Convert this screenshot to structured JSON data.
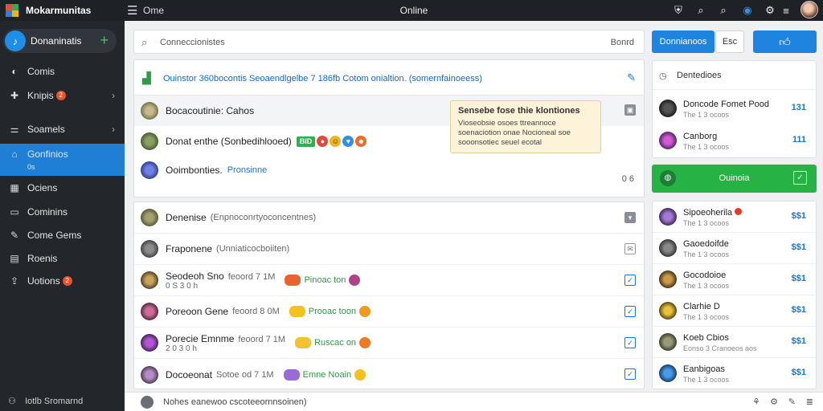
{
  "topbar": {
    "brand": "Mokarmunitas",
    "crumb": "Ome",
    "center": "Online",
    "icons": [
      "shield-icon",
      "search-icon",
      "search-icon",
      "globe-icon",
      "settings-icon",
      "sliders-icon"
    ]
  },
  "sidebar": {
    "title": "Donaninatis",
    "items": [
      {
        "label": "Comis",
        "icon": "compass-icon",
        "badge": "",
        "chevron": false
      },
      {
        "label": "Knipis",
        "icon": "puzzle-icon",
        "badge": "2",
        "chevron": true
      },
      {
        "label": "Soamels",
        "icon": "sliders-icon",
        "badge": "",
        "chevron": true
      },
      {
        "label": "Gonfinios",
        "icon": "home-icon",
        "sub": "0s",
        "active": true
      },
      {
        "label": "Ociens",
        "icon": "grid-icon",
        "badge": ""
      },
      {
        "label": "Cominins",
        "icon": "clipboard-icon",
        "badge": ""
      },
      {
        "label": "Come Gems",
        "icon": "bookmark-icon",
        "badge": ""
      },
      {
        "label": "Roenis",
        "icon": "file-icon",
        "badge": ""
      },
      {
        "label": "Uotions",
        "icon": "upload-icon",
        "badge": "2"
      }
    ],
    "footer": "Iotlb Sromarnd"
  },
  "search": {
    "placeholder": "Conneccionistes",
    "button": "Bonrd"
  },
  "banner": {
    "text": "Ouinstor 360bocontis Seoaendlgelbe 7 186fb Cotom onialtion. (somernfainoeess)"
  },
  "feed": [
    {
      "name": "Bocacoutinie: Cahos",
      "meta": "",
      "link": ""
    },
    {
      "name": "Donat enthe (Sonbedihlooed)",
      "meta": "",
      "tag": "BID"
    },
    {
      "name": "Ooimbonties.",
      "meta": "",
      "link": "Pronsinne"
    }
  ],
  "tooltip": {
    "title": "Sensebe fose thie klontiones",
    "body": "Vioseobsie osoes ttreannoce soenaciotion onae Nocioneal soe sooonsotiec seuel ecotal"
  },
  "feed_count": "0 6",
  "games": [
    {
      "name": "Denenise",
      "size": "(Enpnoconrtyoconcentnes)",
      "category": "",
      "checked": false,
      "control": "grey"
    },
    {
      "name": "Fraponene",
      "size": "(Unniaticocboiiten)",
      "category": "",
      "checked": false,
      "control": "plain"
    },
    {
      "name": "Seodeoh Sno",
      "size": "feoord 7 1M",
      "sub": "0 S 3 0 h",
      "category": "Pinoac ton",
      "checked": true
    },
    {
      "name": "Poreoon Gene",
      "size": "feoord 8 0M",
      "sub": "",
      "category": "Prooac toon",
      "checked": true
    },
    {
      "name": "Porecie Emnme",
      "size": "feoord 7 1M",
      "sub": "2 0 3 0 h",
      "category": "Ruscac on",
      "checked": true
    },
    {
      "name": "Docoeonat",
      "size": "Sotoe od 7 1M",
      "sub": "",
      "category": "Emne Noain",
      "checked": true
    }
  ],
  "bottombar": {
    "text": "Nohes eanewoo cscoteeornnsoinen)"
  },
  "right": {
    "buttons": [
      "Donnianoos",
      "Esc"
    ],
    "panel_title": "Dentedioes",
    "top_items": [
      {
        "name": "Doncode Fomet Pood",
        "sub": "The 1 3 ocoos",
        "value": "131"
      },
      {
        "name": "Canborg",
        "sub": "The 1 3 ocoos",
        "value": "111"
      }
    ],
    "green_label": "Ouinoia",
    "items": [
      {
        "name": "Sipoeoherila",
        "sub": "The 1 3 ocoos",
        "value": "$$1",
        "dot": true
      },
      {
        "name": "Gaoedoifde",
        "sub": "The 1 3 ocoos",
        "value": "$$1"
      },
      {
        "name": "Gocodoioe",
        "sub": "The 1 3 ocoos",
        "value": "$$1"
      },
      {
        "name": "Clarhie D",
        "sub": "The 1 3 ocoos",
        "value": "$$1"
      },
      {
        "name": "Koeb Cbios",
        "sub": "Eonso 3 Cranoeos aos",
        "value": "$$1"
      },
      {
        "name": "Eanbigoas",
        "sub": "The 1 3 ocoos",
        "value": "$$1"
      }
    ]
  }
}
